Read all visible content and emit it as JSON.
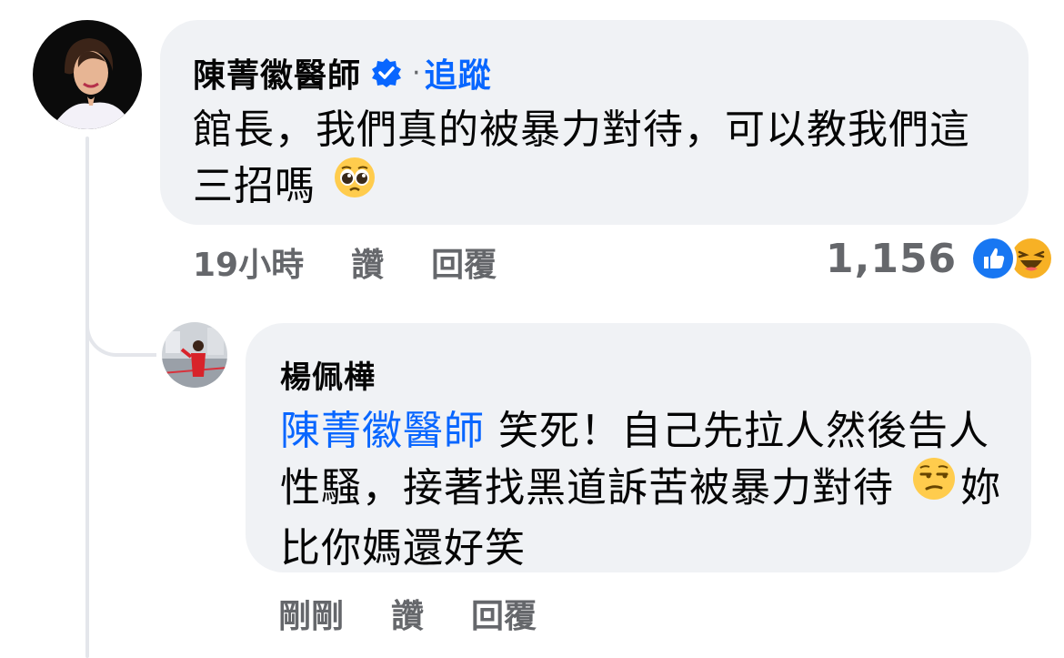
{
  "main_comment": {
    "author": "陳菁徽醫師",
    "follow_separator": "·",
    "follow_label": "追蹤",
    "text": "館長，我們真的被暴力對待，可以教我們這三招嗎",
    "emoji": "pleading-face",
    "time": "19小時",
    "like_label": "讚",
    "reply_label": "回覆",
    "reaction_count": "1,156",
    "reactions": [
      "like-icon",
      "haha-icon"
    ]
  },
  "reply_comment": {
    "author": "楊佩樺",
    "mention": "陳菁徽醫師",
    "text_before_emoji": " 笑死！自己先拉人然後告人性騷，接著找黑道訴苦被暴力對待",
    "emoji": "unamused-face",
    "text_after_emoji": "妳比你媽還好笑",
    "time": "剛剛",
    "like_label": "讚",
    "reply_label": "回覆"
  },
  "colors": {
    "bubble": "#f0f2f5",
    "link": "#0866ff",
    "meta": "#65676b",
    "thread_line": "#e4e6eb"
  }
}
